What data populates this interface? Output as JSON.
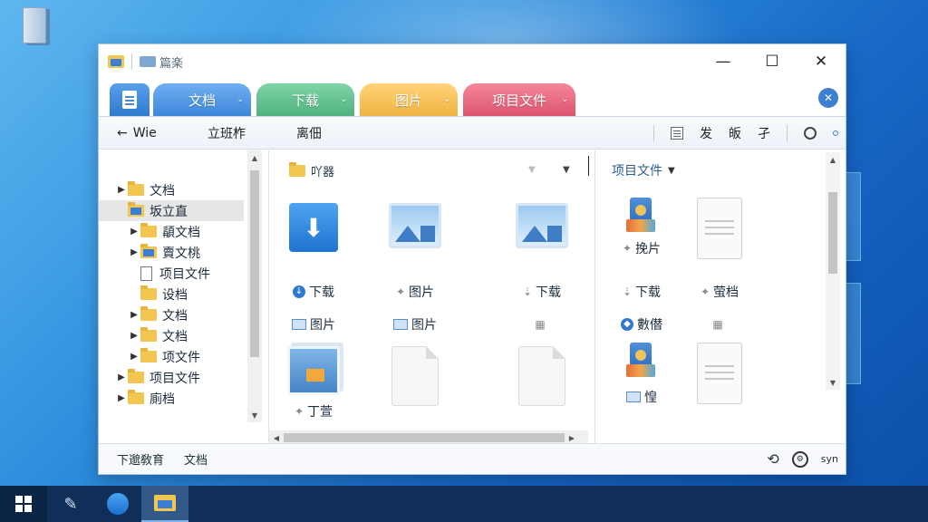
{
  "desktop": {
    "icon_label": ""
  },
  "window": {
    "title": "篇楽",
    "controls": {
      "minimize": "—",
      "maximize": "☐",
      "close": "✕"
    }
  },
  "tabs": [
    {
      "label": "文档",
      "color": "#4a93e4"
    },
    {
      "label": "下载",
      "color": "#5fc08e"
    },
    {
      "label": "图片",
      "color": "#f4c25a"
    },
    {
      "label": "项目文件",
      "color": "#e8657d"
    }
  ],
  "tab_close": "✕",
  "toolbar": {
    "back_label": "Wie",
    "item1": "立班柞",
    "item2": "离佃",
    "right": [
      "发",
      "皈",
      "孑"
    ]
  },
  "tree": {
    "items": [
      {
        "label": "文档",
        "indent": 0,
        "arrow": "▶",
        "icon": "folder"
      },
      {
        "label": "坂立直",
        "indent": 0,
        "arrow": "",
        "icon": "folder-blue",
        "selected": true
      },
      {
        "label": "䫇文档",
        "indent": 1,
        "arrow": "▶",
        "icon": "folder"
      },
      {
        "label": "賣文桃",
        "indent": 1,
        "arrow": "▶",
        "icon": "folder-blue"
      },
      {
        "label": "项目文件",
        "indent": 1,
        "arrow": "",
        "icon": "doc"
      },
      {
        "label": "设档",
        "indent": 1,
        "arrow": "",
        "icon": "folder"
      },
      {
        "label": "文档",
        "indent": 1,
        "arrow": "▶",
        "icon": "folder"
      },
      {
        "label": "文档",
        "indent": 1,
        "arrow": "▶",
        "icon": "folder"
      },
      {
        "label": "项文件",
        "indent": 1,
        "arrow": "▶",
        "icon": "folder"
      },
      {
        "label": "项目文件",
        "indent": 0,
        "arrow": "▶",
        "icon": "folder"
      },
      {
        "label": "廁档",
        "indent": 0,
        "arrow": "▶",
        "icon": "folder"
      }
    ]
  },
  "middle": {
    "header": "吖器",
    "items_row1": [
      "下载",
      "图片",
      "下载"
    ],
    "items_row2": [
      "图片",
      "图片",
      ""
    ],
    "item_row3": "丁萱"
  },
  "right": {
    "header": "项目文件",
    "items_row1": [
      "挽片",
      ""
    ],
    "items_row2": [
      "下载",
      "萤档"
    ],
    "items_row3": [
      "數僣",
      ""
    ],
    "item_row4": "惶"
  },
  "status": {
    "left": "下邈敎育",
    "middle": "文档",
    "right": "syn"
  }
}
